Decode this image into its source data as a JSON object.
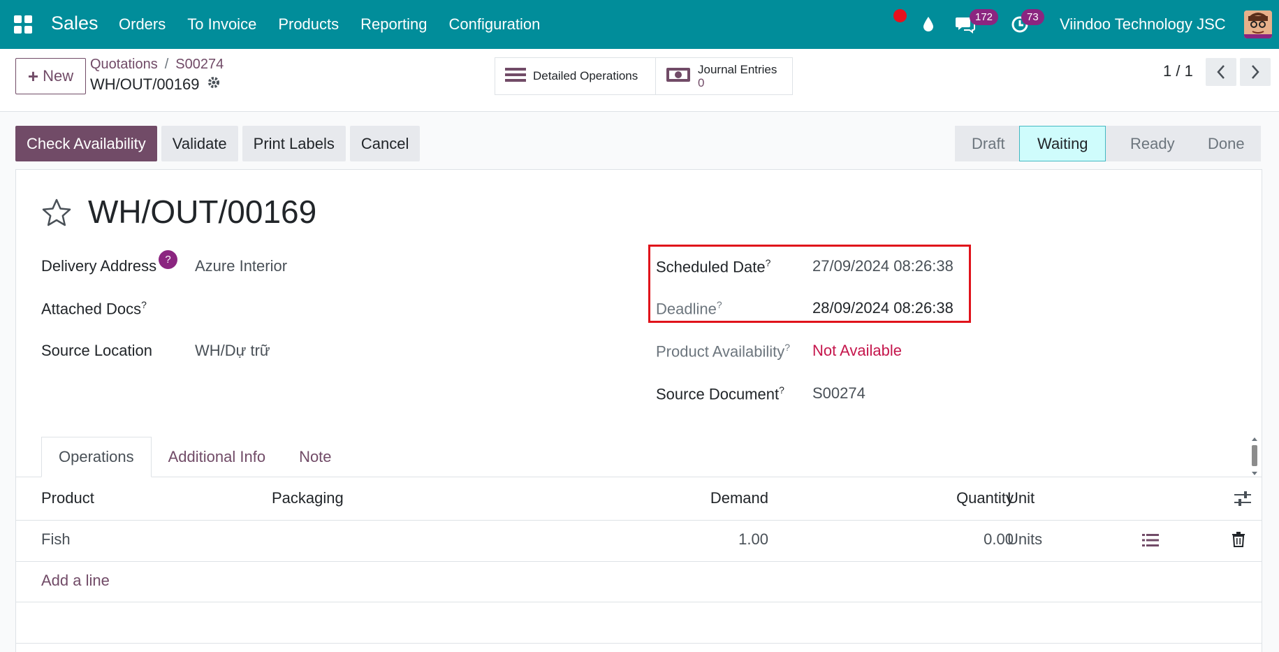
{
  "navbar": {
    "app_name": "Sales",
    "menu": [
      "Orders",
      "To Invoice",
      "Products",
      "Reporting",
      "Configuration"
    ],
    "chat_badge": "172",
    "activity_badge": "73",
    "company": "Viindoo Technology JSC"
  },
  "control": {
    "new_label": "New",
    "breadcrumb": [
      "Quotations",
      "S00274"
    ],
    "record_name": "WH/OUT/00169",
    "detailed_operations_label": "Detailed Operations",
    "journal_entries_label": "Journal Entries",
    "journal_entries_count": "0",
    "pager": "1 / 1"
  },
  "actions": {
    "check_availability": "Check Availability",
    "validate": "Validate",
    "print_labels": "Print Labels",
    "cancel": "Cancel"
  },
  "statusbar": [
    "Draft",
    "Waiting",
    "Ready",
    "Done"
  ],
  "status_active": "Waiting",
  "form": {
    "title": "WH/OUT/00169",
    "delivery_address_label": "Delivery Address",
    "delivery_address_help": "?",
    "delivery_address": "Azure Interior",
    "attached_docs_label": "Attached Docs",
    "source_location_label": "Source Location",
    "source_location": "WH/Dự trữ",
    "scheduled_date_label": "Scheduled Date",
    "scheduled_date": "27/09/2024 08:26:38",
    "deadline_label": "Deadline",
    "deadline": "28/09/2024 08:26:38",
    "product_availability_label": "Product Availability",
    "product_availability": "Not Available",
    "source_document_label": "Source Document",
    "source_document": "S00274",
    "help_mark": "?"
  },
  "tabs": [
    "Operations",
    "Additional Info",
    "Note"
  ],
  "table": {
    "headers": {
      "product": "Product",
      "packaging": "Packaging",
      "demand": "Demand",
      "quantity": "Quantity",
      "unit": "Unit"
    },
    "rows": [
      {
        "product": "Fish",
        "packaging": "",
        "demand": "1.00",
        "quantity": "0.00",
        "unit": "Units"
      }
    ],
    "add_line": "Add a line"
  },
  "colors": {
    "navbar": "#018d9a",
    "primary": "#714b67",
    "badge": "#8b2580",
    "danger": "#c5164c",
    "highlight": "#e0131b"
  }
}
